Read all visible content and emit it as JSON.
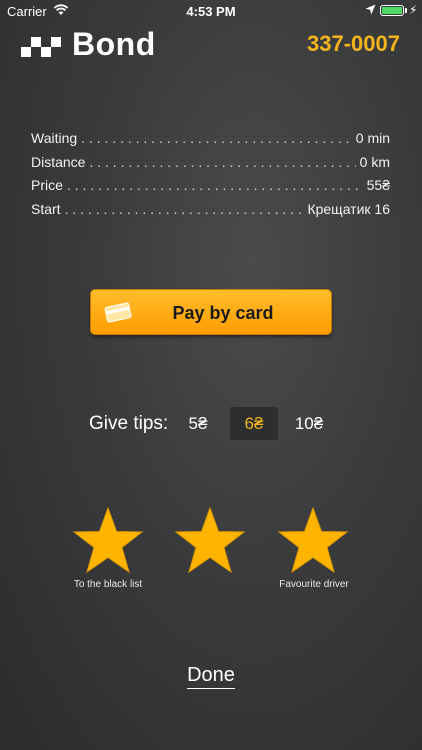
{
  "status_bar": {
    "carrier": "Carrier",
    "time": "4:53 PM",
    "bolt": "⚡"
  },
  "header": {
    "brand": "Bond",
    "phone": "337-0007",
    "accent_color": "#f4b51c"
  },
  "trip": {
    "rows": [
      {
        "label": "Waiting",
        "value": "0 min"
      },
      {
        "label": "Distance",
        "value": "0 km"
      },
      {
        "label": "Price",
        "value": "55₴"
      },
      {
        "label": "Start",
        "value": "Крещатик 16"
      }
    ]
  },
  "payment": {
    "pay_button_label": "Pay by card",
    "button_color": "#ff9d00"
  },
  "tips": {
    "label": "Give tips:",
    "options": [
      "5₴",
      "6₴",
      "10₴"
    ],
    "selected": "6₴"
  },
  "rating": {
    "star_icon": "star-icon",
    "star_color": "#ffb400",
    "left_caption": "To the black list",
    "right_caption": "Favourite driver"
  },
  "done_label": "Done"
}
